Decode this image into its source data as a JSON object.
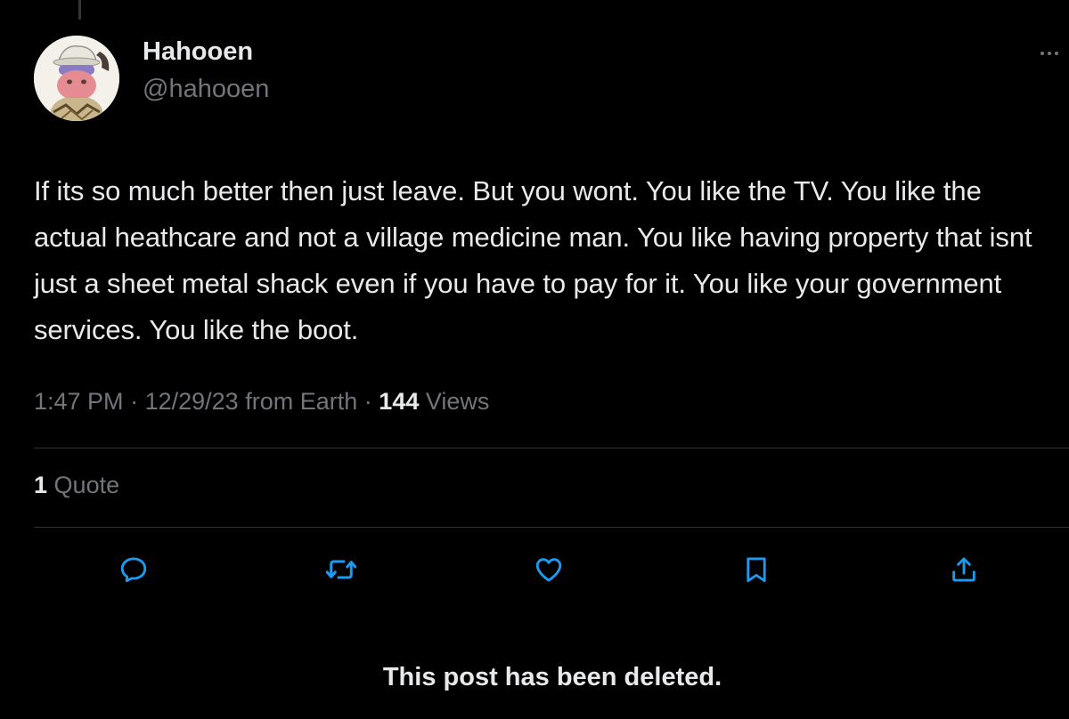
{
  "colors": {
    "background": "#000000",
    "primary_text": "#e7e9ea",
    "secondary_text": "#71767b",
    "divider": "#2f3336",
    "action_icon": "#1d9bf0"
  },
  "author": {
    "display_name": "Hahooen",
    "handle": "@hahooen",
    "avatar_icon": "cartoon-character-avatar"
  },
  "post": {
    "text": "If its so much better then just leave. But you wont. You like the TV. You like the actual heathcare and not a village medicine man. You like having property that isnt just a sheet metal shack even if you have to pay for it. You like your government services. You like the boot.",
    "time": "1:47 PM",
    "date": "12/29/23",
    "source": "from Earth",
    "separator": "·",
    "views_count": "144",
    "views_label": "Views"
  },
  "engagement": {
    "quote_count": "1",
    "quote_label": "Quote"
  },
  "actions": [
    {
      "name": "reply",
      "icon": "reply-icon"
    },
    {
      "name": "repost",
      "icon": "repost-icon"
    },
    {
      "name": "like",
      "icon": "heart-icon"
    },
    {
      "name": "bookmark",
      "icon": "bookmark-icon"
    },
    {
      "name": "share",
      "icon": "share-icon"
    }
  ],
  "notice": {
    "deleted_text": "This post has been deleted."
  }
}
